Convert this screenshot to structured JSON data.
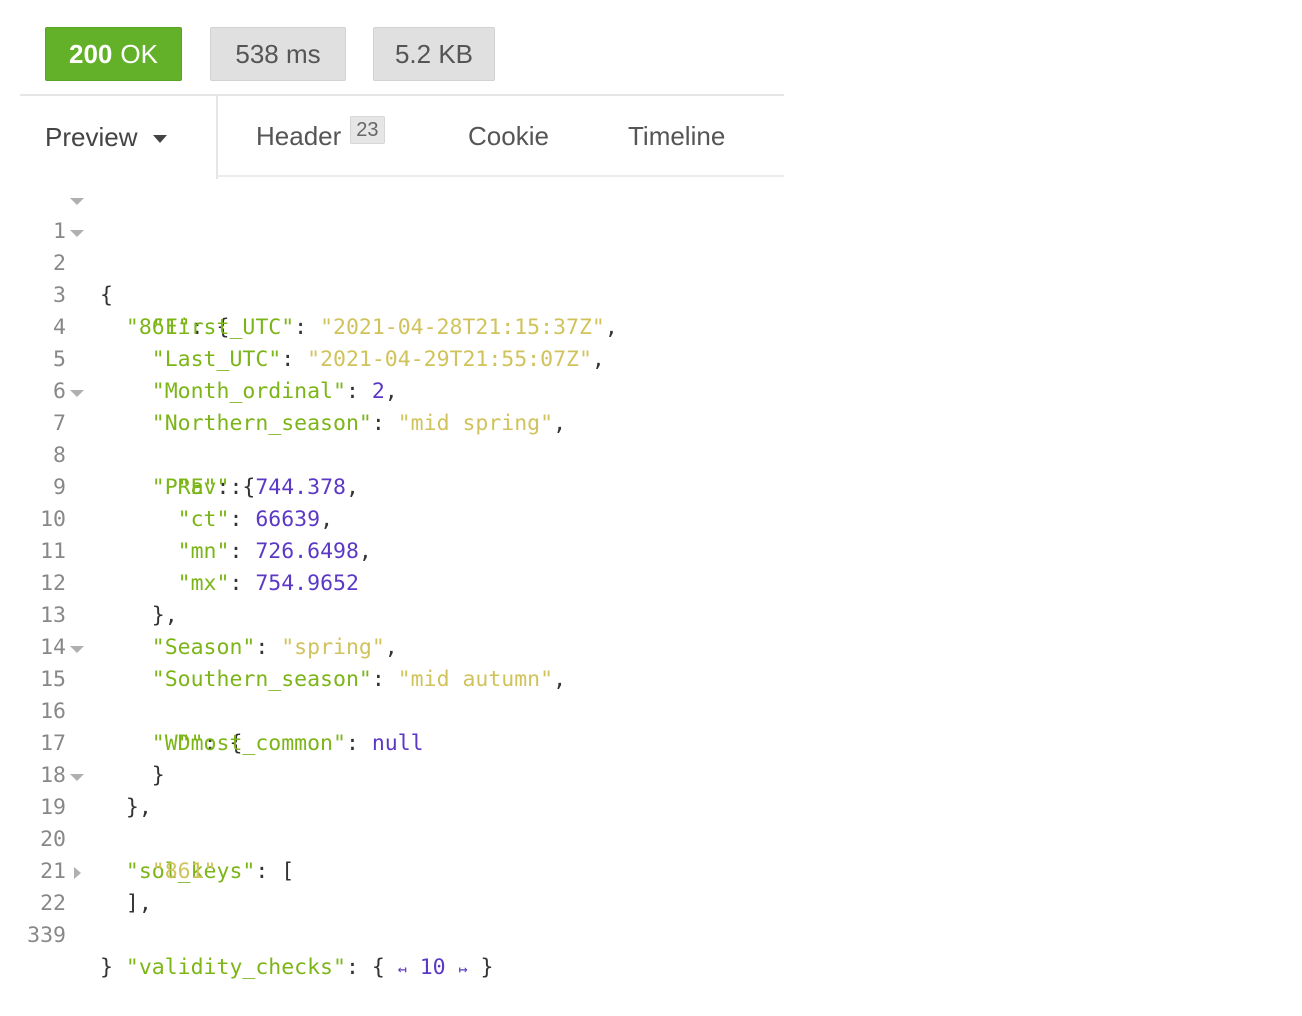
{
  "status": {
    "code": "200",
    "text": "OK",
    "time": "538 ms",
    "size": "5.2 KB",
    "ok_color": "#62b129"
  },
  "tabs": {
    "preview": "Preview",
    "header": "Header",
    "header_count": "23",
    "cookie": "Cookie",
    "timeline": "Timeline"
  },
  "code": {
    "lines": [
      {
        "no": "1",
        "fold": "open"
      },
      {
        "no": "2",
        "fold": "open",
        "key": "\"861\""
      },
      {
        "no": "3",
        "key": "\"First_UTC\"",
        "value": "\"2021-04-28T21:15:37Z\""
      },
      {
        "no": "4",
        "key": "\"Last_UTC\"",
        "value": "\"2021-04-29T21:55:07Z\""
      },
      {
        "no": "5",
        "key": "\"Month_ordinal\"",
        "value": "2"
      },
      {
        "no": "6",
        "key": "\"Northern_season\"",
        "value": "\"mid spring\""
      },
      {
        "no": "7",
        "fold": "open",
        "key": "\"PRE\""
      },
      {
        "no": "8",
        "key": "\"av\"",
        "value": "744.378"
      },
      {
        "no": "9",
        "key": "\"ct\"",
        "value": "66639"
      },
      {
        "no": "10",
        "key": "\"mn\"",
        "value": "726.6498"
      },
      {
        "no": "11",
        "key": "\"mx\"",
        "value": "754.9652"
      },
      {
        "no": "12"
      },
      {
        "no": "13",
        "key": "\"Season\"",
        "value": "\"spring\""
      },
      {
        "no": "14",
        "key": "\"Southern_season\"",
        "value": "\"mid autumn\""
      },
      {
        "no": "15",
        "fold": "open",
        "key": "\"WD\""
      },
      {
        "no": "16",
        "key": "\"most_common\"",
        "value": "null"
      },
      {
        "no": "17"
      },
      {
        "no": "18"
      },
      {
        "no": "19",
        "fold": "open",
        "key": "\"sol_keys\""
      },
      {
        "no": "20",
        "value": "\"861\""
      },
      {
        "no": "21"
      },
      {
        "no": "22",
        "fold": "closed",
        "key": "\"validity_checks\"",
        "collapsed_count": "10"
      },
      {
        "no": "339"
      }
    ]
  }
}
